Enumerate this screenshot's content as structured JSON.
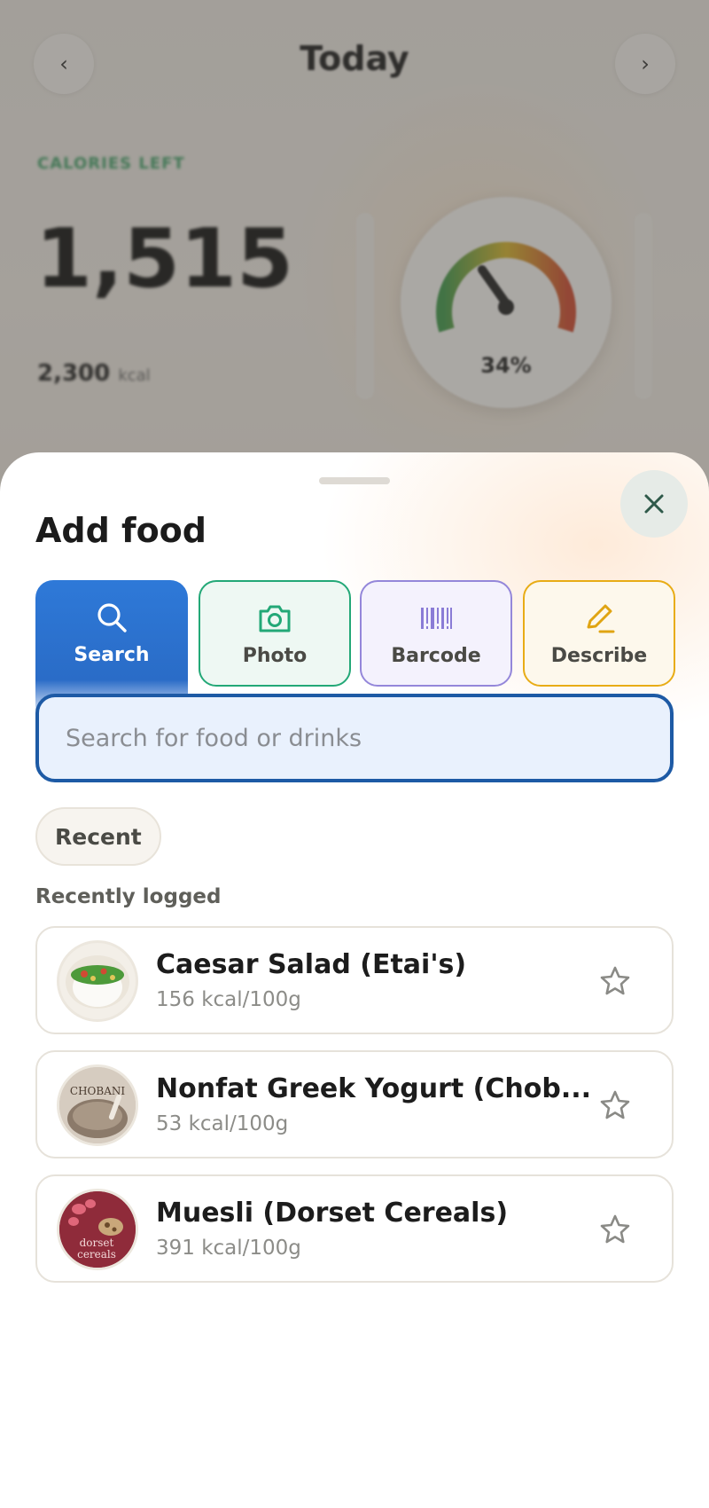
{
  "background": {
    "title": "Today",
    "calories_left_label": "CALORIES LEFT",
    "calories_left_value": "1,515",
    "goal_value": "2,300",
    "goal_unit": "kcal",
    "gauge_percent": "34%"
  },
  "sheet": {
    "title": "Add food",
    "tabs": [
      {
        "label": "Search",
        "icon": "search-icon"
      },
      {
        "label": "Photo",
        "icon": "camera-icon"
      },
      {
        "label": "Barcode",
        "icon": "barcode-icon"
      },
      {
        "label": "Describe",
        "icon": "pencil-icon"
      }
    ],
    "search": {
      "placeholder": "Search for food or drinks",
      "value": ""
    },
    "chip": "Recent",
    "section_label": "Recently logged",
    "foods": [
      {
        "name": "Caesar Salad (Etai's)",
        "kcal": "156 kcal/100g",
        "thumb": "salad-bowl"
      },
      {
        "name": "Nonfat Greek Yogurt (Chob...",
        "kcal": "53 kcal/100g",
        "thumb": "yogurt-cup",
        "thumb_text": "CHOBANI"
      },
      {
        "name": "Muesli (Dorset Cereals)",
        "kcal": "391 kcal/100g",
        "thumb": "muesli-box",
        "thumb_text": "dorset cereals"
      }
    ]
  },
  "colors": {
    "search_tab": "#2e79d8",
    "photo_tab": "#23a877",
    "barcode_tab": "#9487da",
    "describe_tab": "#e8ac16",
    "search_border": "#1d5aa5"
  }
}
